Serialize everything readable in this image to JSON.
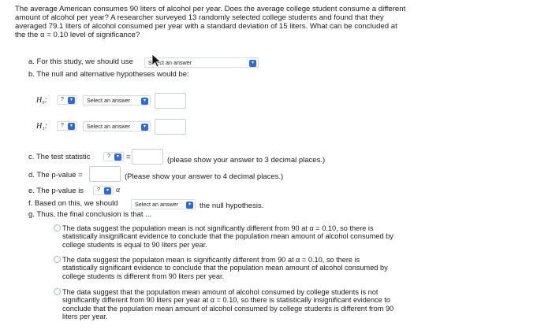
{
  "intro": "The average American consumes 90 liters of alcohol per year. Does the average college student consume a different amount of alcohol per year? A researcher surveyed 13 randomly selected college students and found that they averaged 79.1 liters of alcohol consumed per year with a standard deviation of 15 liters. What can be concluded at the the α = 0.10 level of significance?",
  "a": {
    "label": "a.  For this study, we should use",
    "select_value": "Select an answer"
  },
  "b": {
    "label": "b.  The null and alternative hypotheses would be:"
  },
  "h0": {
    "label": "H₀:",
    "symbol": "?",
    "select_value": "Select an answer"
  },
  "h1": {
    "label": "H₁:",
    "symbol": "?",
    "select_value": "Select an answer"
  },
  "c": {
    "label": "c.  The test statistic",
    "symbol": "?",
    "equals": "=",
    "note": "(please show your answer to 3 decimal places.)"
  },
  "d": {
    "label": "d.  The p-value =",
    "note": "(Please show your answer to 4 decimal places.)"
  },
  "e": {
    "label": "e.  The p-value is",
    "symbol": "?",
    "alpha": "α"
  },
  "f": {
    "label": "f.  Based on this, we should",
    "select_value": "Select an answer",
    "suffix": "the null hypothesis."
  },
  "g": {
    "label": "g.  Thus, the final conclusion is that ...",
    "options": [
      "The data suggest the population mean is not significantly different from 90 at α = 0.10, so there is statistically insignificant evidence to conclude that the population mean amount of alcohol consumed by college students is equal to 90 liters per year.",
      "The data suggest the populaton mean is significantly different from 90 at α = 0.10, so there is statistically significant evidence to conclude that the population mean amount of alcohol consumed by college students is different from 90 liters per year.",
      "The data suggest that the population mean amount of alcohol consumed by college students is not significantly different from 90 liters per year at α = 0.10, so there is statistically insignificant evidence to conclude that the population mean amount of alcohol consumed by college students is different from 90 liters per year."
    ]
  },
  "colors": {
    "accent": "#2f6bd0",
    "input_border": "#c9ced6",
    "radio_border": "#9fb4d4"
  },
  "icons": {
    "dropdown": "chevron-down-icon",
    "cursor": "mouse-cursor-icon"
  }
}
